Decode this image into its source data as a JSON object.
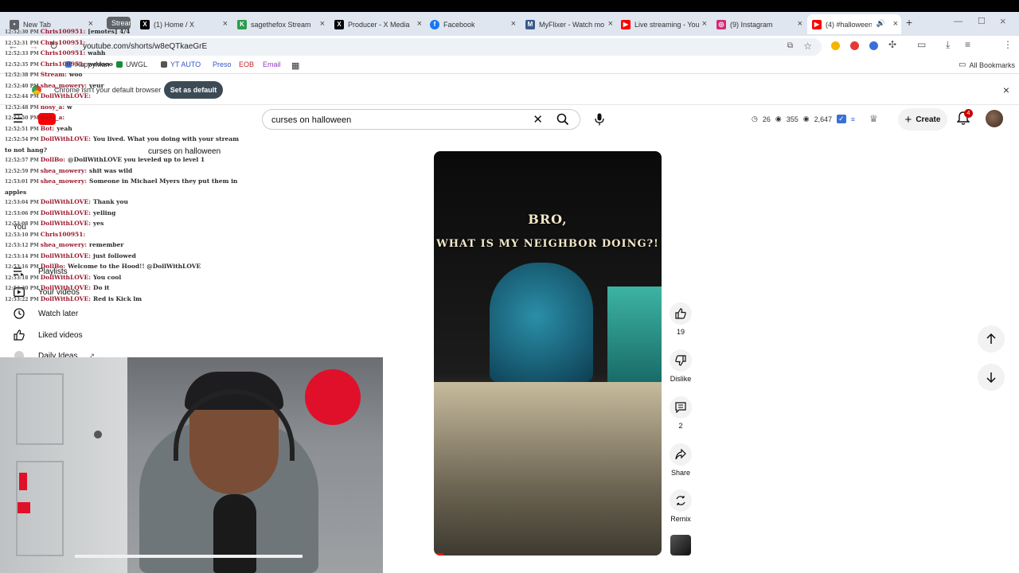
{
  "browser": {
    "tabs": [
      {
        "label": "New Tab",
        "color": "#5f6368",
        "glyph": "•"
      },
      {
        "label": "Stream",
        "color": "#5f6368",
        "glyph": "S"
      },
      {
        "label": "(1) Home / X",
        "color": "#000000",
        "glyph": "X"
      },
      {
        "label": "sagethefox Stream",
        "color": "#2a9d4a",
        "glyph": "K"
      },
      {
        "label": "Producer - X Media",
        "color": "#000000",
        "glyph": "X"
      },
      {
        "label": "Facebook",
        "color": "#1877f2",
        "glyph": "f"
      },
      {
        "label": "MyFlixer - Watch mo",
        "color": "#3a5a8a",
        "glyph": "M"
      },
      {
        "label": "Live streaming - You",
        "color": "#ff0000",
        "glyph": "▶"
      },
      {
        "label": "(9) Instagram",
        "color": "#d62976",
        "glyph": "◎"
      },
      {
        "label": "(4) #halloweend",
        "color": "#ff0000",
        "glyph": "▶"
      }
    ],
    "url": "youtube.com/shorts/w8eQTkaeGrE",
    "bookmarks": [
      "HappyMan",
      "UWGL",
      "YT AUTO",
      "Preso",
      "EOB",
      "Email"
    ],
    "all_bookmarks": "All Bookmarks",
    "infobar_msg": "Chrome isn't your default browser",
    "infobar_btn": "Set as default"
  },
  "youtube": {
    "search_query": "curses on halloween",
    "suggestion": "curses on halloween",
    "stats": [
      "26",
      "355",
      "2,647"
    ],
    "create_label": "Create",
    "notif_count": "4",
    "sidebar": [
      {
        "label": "Playlists",
        "icon": "playlist-icon"
      },
      {
        "label": "Your videos",
        "icon": "your-videos-icon"
      },
      {
        "label": "Watch later",
        "icon": "clock-icon"
      },
      {
        "label": "Liked videos",
        "icon": "thumbs-up-icon"
      },
      {
        "label": "Daily Ideas",
        "icon": "ideas-icon"
      }
    ],
    "you_label": "You",
    "video": {
      "caption1": "BRO,",
      "caption2": "WHAT IS MY NEIGHBOR DOING?!"
    },
    "actions": {
      "likes": "19",
      "dislike": "Dislike",
      "comments": "2",
      "share": "Share",
      "remix": "Remix"
    }
  },
  "chat": [
    {
      "ts": "12:52:30 PM",
      "user": "Chris100951:",
      "msg": "[emotes] 4/4"
    },
    {
      "ts": "12:52:31 PM",
      "user": "Chris100951:",
      "msg": ""
    },
    {
      "ts": "12:52:33 PM",
      "user": "Chris100951:",
      "msg": "wahh"
    },
    {
      "ts": "12:52:35 PM",
      "user": "Chris100951:",
      "msg": "wooooo"
    },
    {
      "ts": "12:52:38 PM",
      "user": "Stream:",
      "msg": "woo"
    },
    {
      "ts": "12:52:40 PM",
      "user": "shea_mowery:",
      "msg": "yeur"
    },
    {
      "ts": "12:52:44 PM",
      "user": "DollWithLOVE:",
      "msg": ""
    },
    {
      "ts": "12:52:48 PM",
      "user": "nosy_a:",
      "msg": "w"
    },
    {
      "ts": "12:52:50 PM",
      "user": "nosy_a:",
      "msg": ""
    },
    {
      "ts": "12:52:51 PM",
      "user": "Bot:",
      "msg": "yeah"
    },
    {
      "ts": "12:52:54 PM",
      "user": "DollWithLOVE:",
      "msg": "You lived. What you doing with your stream to not hang?"
    },
    {
      "ts": "12:52:57 PM",
      "user": "DollBo:",
      "msg": "@DollWithLOVE you leveled up to level 1"
    },
    {
      "ts": "12:52:59 PM",
      "user": "shea_mowery:",
      "msg": "shit was wild"
    },
    {
      "ts": "12:53:01 PM",
      "user": "shea_mowery:",
      "msg": "Someone in Michael Myers they put them in apples"
    },
    {
      "ts": "12:53:04 PM",
      "user": "DollWithLOVE:",
      "msg": "Thank you"
    },
    {
      "ts": "12:53:06 PM",
      "user": "DollWithLOVE:",
      "msg": "yelling"
    },
    {
      "ts": "12:53:08 PM",
      "user": "DollWithLOVE:",
      "msg": "yes"
    },
    {
      "ts": "12:53:10 PM",
      "user": "Chris100951:",
      "msg": ""
    },
    {
      "ts": "12:53:12 PM",
      "user": "shea_mowery:",
      "msg": "remember"
    },
    {
      "ts": "12:53:14 PM",
      "user": "DollWithLOVE:",
      "msg": "just followed"
    },
    {
      "ts": "12:53:16 PM",
      "user": "DollBo:",
      "msg": "Welcome to the Hood!! @DollWithLOVE"
    },
    {
      "ts": "12:53:18 PM",
      "user": "DollWithLOVE:",
      "msg": "You cool"
    },
    {
      "ts": "12:53:20 PM",
      "user": "DollWithLOVE:",
      "msg": "Do it"
    },
    {
      "ts": "12:53:22 PM",
      "user": "DollWithLOVE:",
      "msg": "Red is Kick lm"
    }
  ]
}
